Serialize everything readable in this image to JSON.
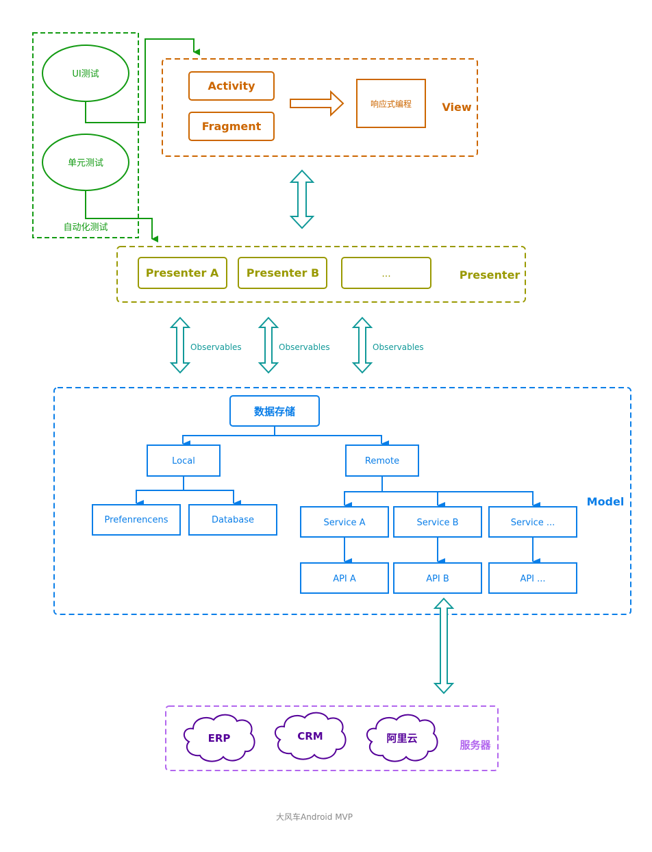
{
  "testing": {
    "group_label": "自动化测试",
    "ui_test": "UI测试",
    "unit_test": "单元测试",
    "color": "#129a12"
  },
  "view": {
    "label": "View",
    "activity": "Activity",
    "fragment": "Fragment",
    "reactive": "响应式编程",
    "color": "#cc6600"
  },
  "presenter": {
    "label": "Presenter",
    "items": [
      "Presenter A",
      "Presenter B",
      "..."
    ],
    "color": "#999900"
  },
  "observables": {
    "labels": [
      "Observables",
      "Observables",
      "Observables"
    ],
    "color": "#119999"
  },
  "model": {
    "label": "Model",
    "root": "数据存储",
    "local": "Local",
    "remote": "Remote",
    "local_children": [
      "Prefenrencens",
      "Database"
    ],
    "services": [
      "Service A",
      "Service B",
      "Service ..."
    ],
    "apis": [
      "API A",
      "API B",
      "API ..."
    ],
    "color": "#0a7ee8"
  },
  "servers": {
    "label": "服务器",
    "items": [
      "ERP",
      "CRM",
      "阿里云"
    ],
    "color": "#b266ee",
    "cloud_color": "#550099"
  },
  "footer": {
    "caption": "大风车Android MVP"
  }
}
